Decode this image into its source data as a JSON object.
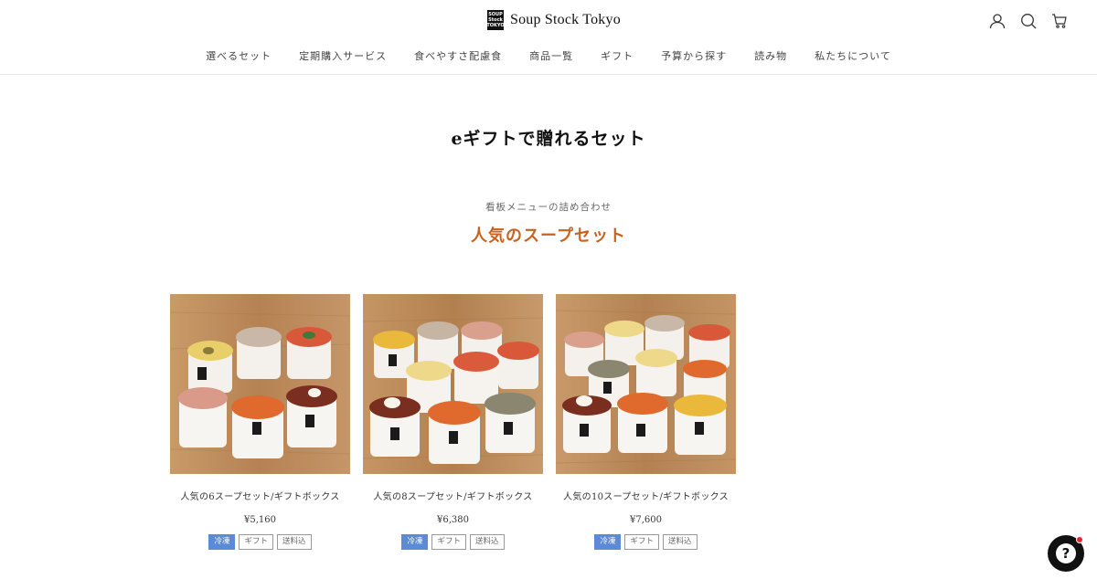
{
  "header": {
    "logo_text": "Soup Stock Tokyo",
    "logo_mark_lines": [
      "SOUP",
      "Stock",
      "TOKYO"
    ],
    "icons": [
      "user-icon",
      "search-icon",
      "cart-icon"
    ]
  },
  "nav": [
    {
      "label": "選べるセット"
    },
    {
      "label": "定期購入サービス"
    },
    {
      "label": "食べやすさ配慮食"
    },
    {
      "label": "商品一覧"
    },
    {
      "label": "ギフト"
    },
    {
      "label": "予算から探す"
    },
    {
      "label": "読み物"
    },
    {
      "label": "私たちについて"
    }
  ],
  "page_title": "eギフトで贈れるセット",
  "section": {
    "subtitle": "看板メニューの詰め合わせ",
    "title": "人気のスープセット"
  },
  "products": [
    {
      "name": "人気の6スープセット/ギフトボックス",
      "price": "¥5,160",
      "tags": [
        "冷凍",
        "ギフト",
        "送料込"
      ]
    },
    {
      "name": "人気の8スープセット/ギフトボックス",
      "price": "¥6,380",
      "tags": [
        "冷凍",
        "ギフト",
        "送料込"
      ]
    },
    {
      "name": "人気の10スープセット/ギフトボックス",
      "price": "¥7,600",
      "tags": [
        "冷凍",
        "ギフト",
        "送料込"
      ]
    }
  ],
  "colors": {
    "accent": "#c9621e",
    "tag_blue": "#5b8bd6",
    "chat_button": "#111111"
  }
}
